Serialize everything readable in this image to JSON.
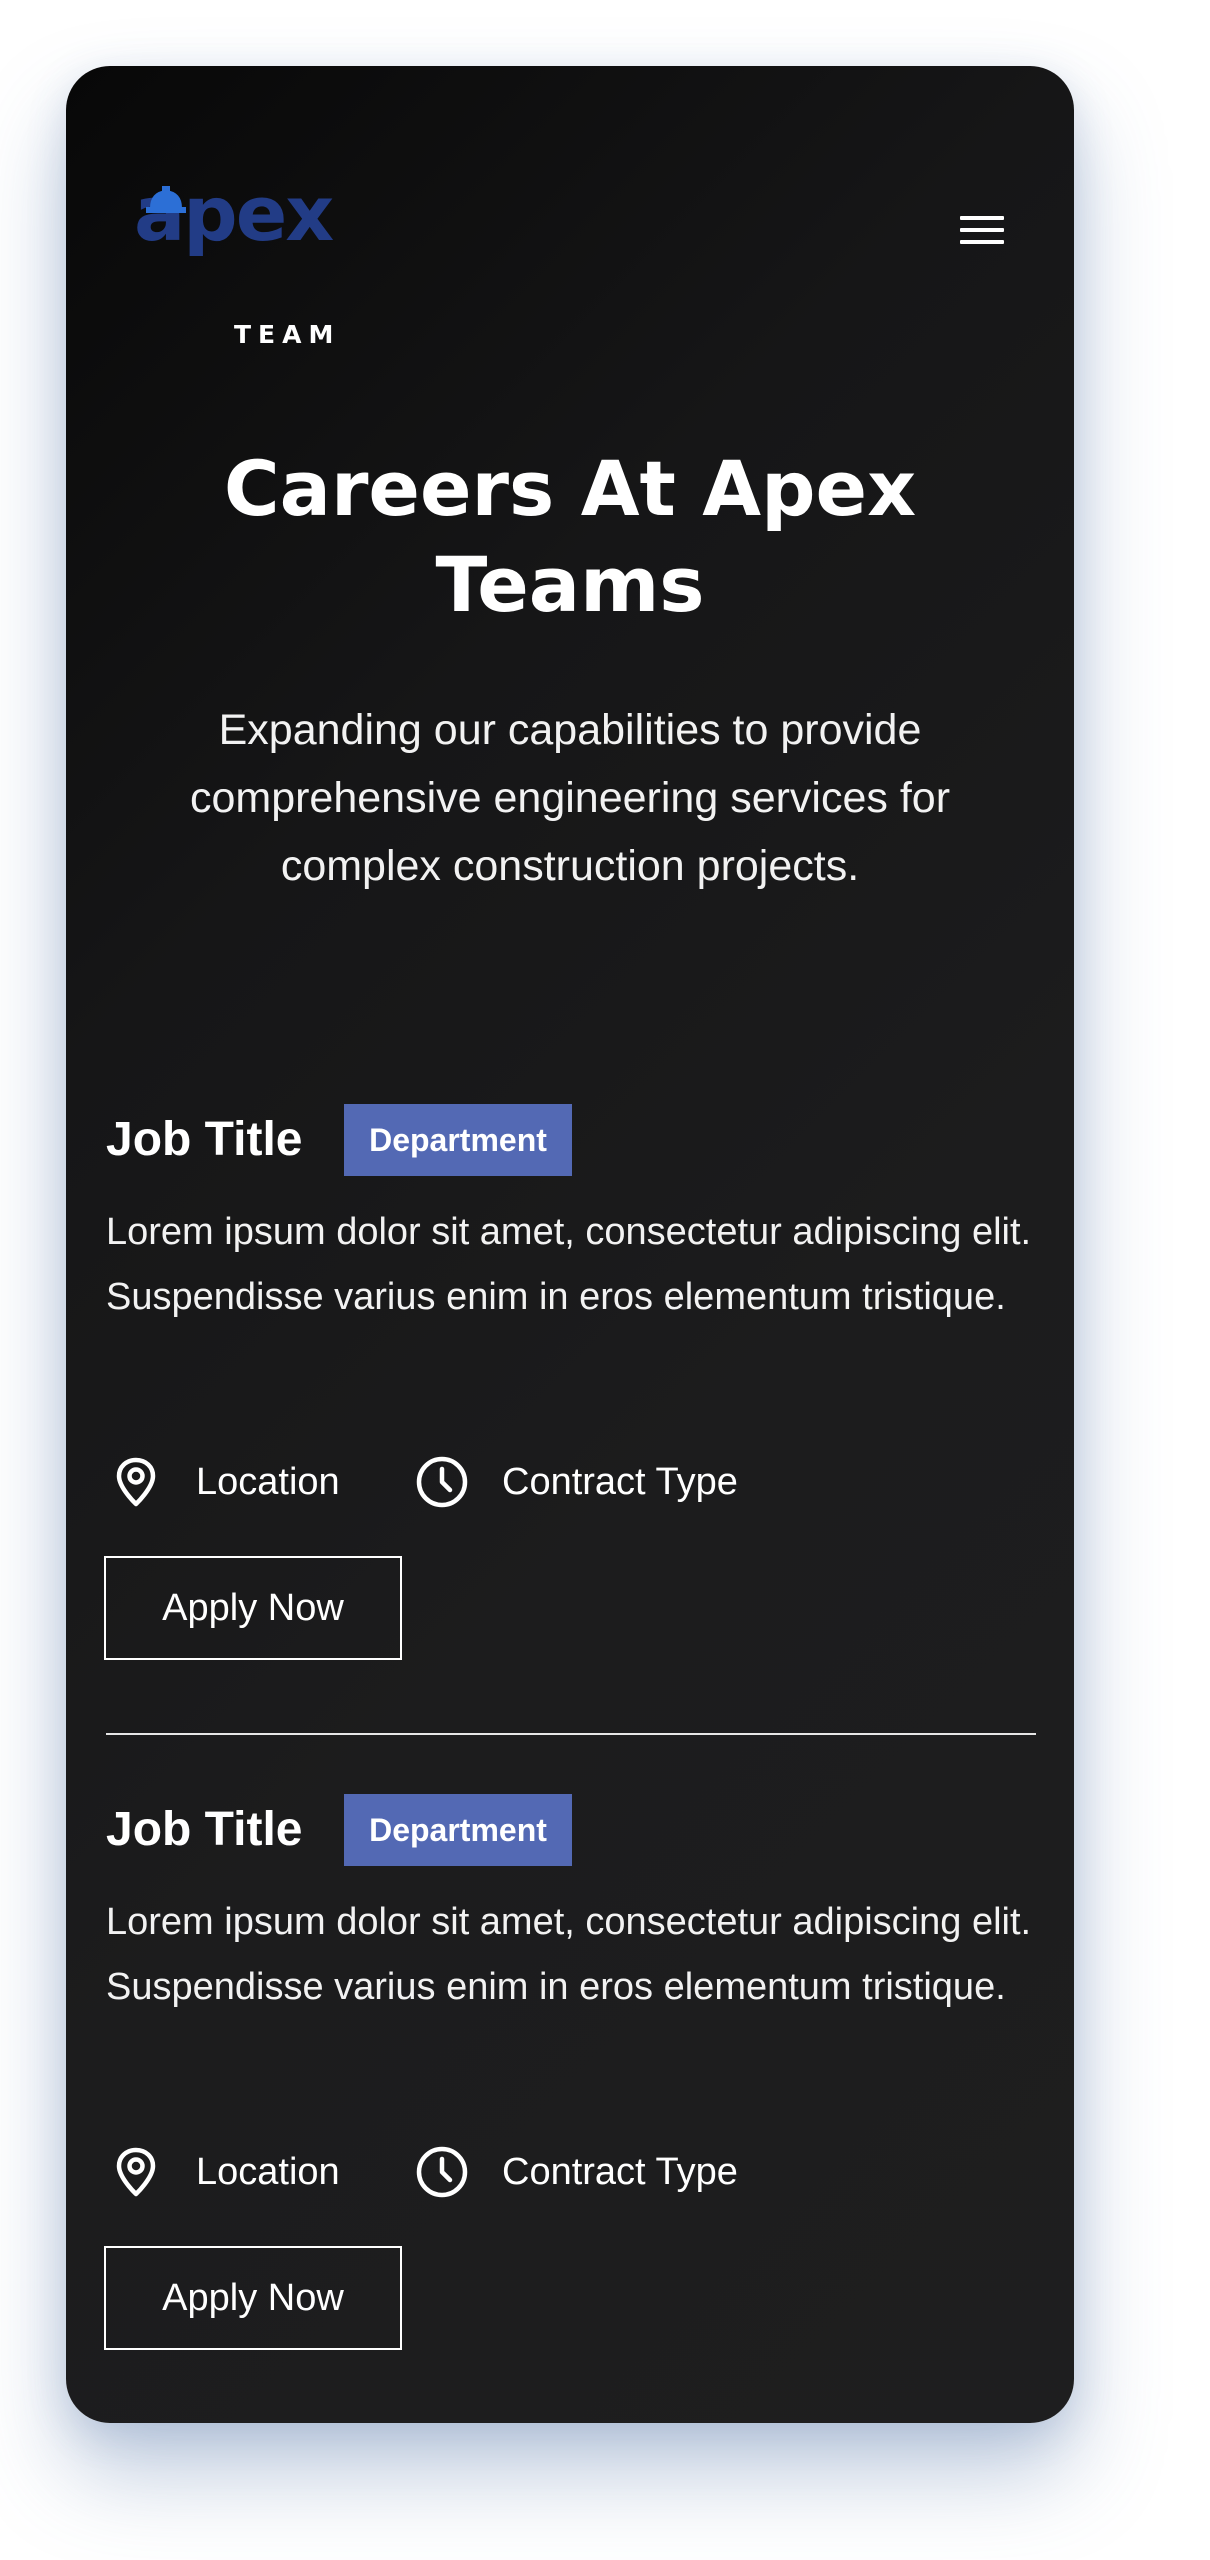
{
  "header": {
    "logo_word": "apex",
    "logo_sub": "TEAM",
    "menu_icon": "hamburger-menu-icon"
  },
  "hero": {
    "title": "Careers At Apex Teams",
    "subtitle": "Expanding our capabilities to provide comprehensive engineering services for complex construction projects."
  },
  "jobs": [
    {
      "title": "Job Title",
      "department": "Department",
      "description": "Lorem ipsum dolor sit amet, consectetur adipiscing elit. Suspendisse varius enim in eros elementum tristique.",
      "location": "Location",
      "contract_type": "Contract Type",
      "apply_label": "Apply Now"
    },
    {
      "title": "Job Title",
      "department": "Department",
      "description": "Lorem ipsum dolor sit amet, consectetur adipiscing elit. Suspendisse varius enim in eros elementum tristique.",
      "location": "Location",
      "contract_type": "Contract Type",
      "apply_label": "Apply Now"
    }
  ],
  "colors": {
    "card_background": "#1c1c1d",
    "badge": "#5369b4",
    "logo_blue": "#223c86",
    "text": "#ffffff"
  }
}
